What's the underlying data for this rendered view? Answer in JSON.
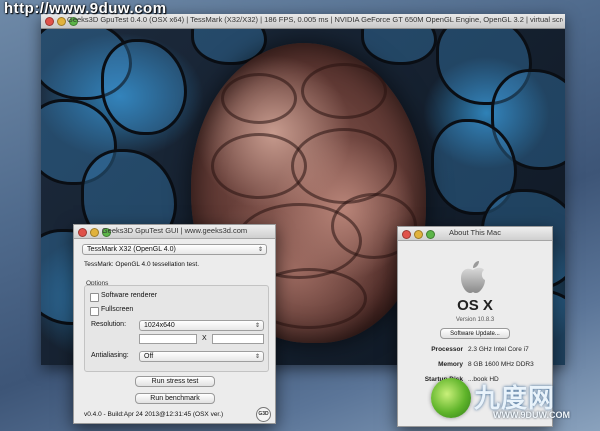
{
  "watermark": {
    "text": "http://www.9duw.com"
  },
  "render_window": {
    "title": "Geeks3D GpuTest 0.4.0 (OSX x64) | TessMark (X32/X32) | 186 FPS, 0.005 ms | NVIDIA GeForce GT 650M OpenGL Engine, OpenGL 3.2 | virtual screen 0"
  },
  "gui_window": {
    "title": "Geeks3D GpuTest GUI | www.geeks3d.com",
    "test_select": "TessMark X32 (OpenGL 4.0)",
    "test_description": "TessMark: OpenGL 4.0 tessellation test.",
    "options_label": "Options",
    "software_renderer_label": "Software renderer",
    "fullscreen_label": "Fullscreen",
    "resolution_label": "Resolution:",
    "resolution_value": "1024x640",
    "x_label": "X",
    "antialiasing_label": "Antialiasing:",
    "antialiasing_value": "Off",
    "run_stress_label": "Run stress test",
    "run_benchmark_label": "Run benchmark",
    "build_info": "v0.4.0 - Build:Apr 24 2013@12:31:45 (OSX ver.)",
    "badge": "G3D"
  },
  "about_window": {
    "title": "About This Mac",
    "os_name": "OS X",
    "version": "Version 10.8.3",
    "software_update_label": "Software Update...",
    "processor_label": "Processor",
    "processor_value": "2.3 GHz Intel Core i7",
    "memory_label": "Memory",
    "memory_value": "8 GB 1600 MHz DDR3",
    "startup_label": "Startup Disk",
    "startup_value": "...book HD"
  },
  "corner_logo": {
    "text": "九度网",
    "url": "WWW.9DUW.COM"
  },
  "colors": {
    "traffic_red": "#e0524a",
    "traffic_yellow": "#e1b23c",
    "traffic_green": "#5cb548"
  }
}
